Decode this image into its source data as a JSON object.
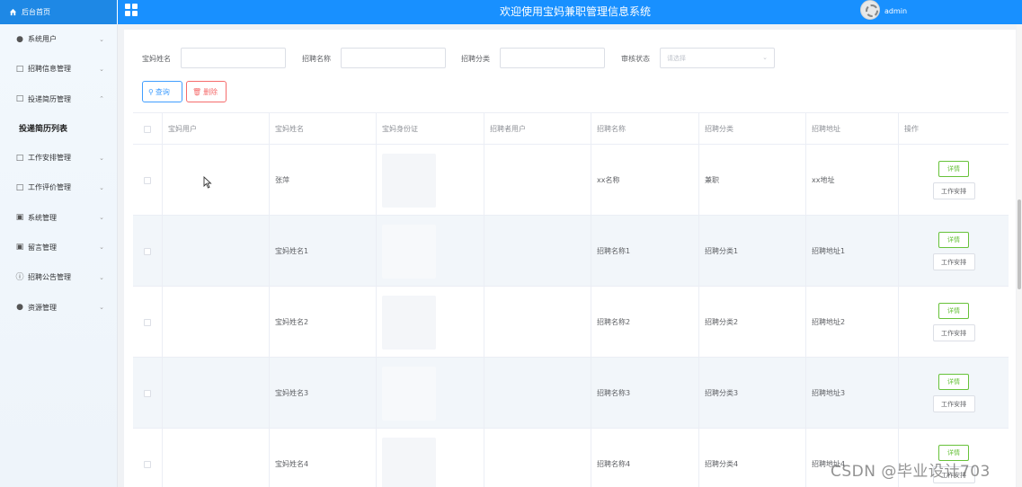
{
  "header": {
    "home_label": "后台首页",
    "title": "欢迎使用宝妈兼职管理信息系统",
    "username": "admin"
  },
  "sidebar": {
    "items": [
      {
        "label": "系统用户",
        "icon": "user-icon",
        "chevron": "down"
      },
      {
        "label": "招聘信息管理",
        "icon": "document-icon",
        "chevron": "down"
      },
      {
        "label": "投递简历管理",
        "icon": "document-icon",
        "chevron": "up"
      },
      {
        "label": "工作安排管理",
        "icon": "document-icon",
        "chevron": "down"
      },
      {
        "label": "工作评价管理",
        "icon": "document-icon",
        "chevron": "down"
      },
      {
        "label": "系统管理",
        "icon": "picture-icon",
        "chevron": "down"
      },
      {
        "label": "留言管理",
        "icon": "picture-icon",
        "chevron": "down"
      },
      {
        "label": "招聘公告管理",
        "icon": "info-icon",
        "chevron": "down"
      },
      {
        "label": "资源管理",
        "icon": "location-icon",
        "chevron": "down"
      }
    ],
    "active_submenu": "投递简历列表"
  },
  "filters": {
    "name_label": "宝妈姓名",
    "name_value": "",
    "job_label": "招聘名称",
    "job_value": "",
    "category_label": "招聘分类",
    "category_value": "",
    "status_label": "审核状态",
    "status_placeholder": "请选择"
  },
  "actions": {
    "query_label": "查询",
    "delete_label": "删除"
  },
  "table": {
    "columns": [
      "宝妈用户",
      "宝妈姓名",
      "宝妈身份证",
      "招聘者用户",
      "招聘名称",
      "招聘分类",
      "招聘地址",
      "操作"
    ],
    "rows": [
      {
        "user": "",
        "name": "张萍",
        "recruiter": "",
        "job": "xx名称",
        "category": "兼职",
        "address": "xx地址"
      },
      {
        "user": "",
        "name": "宝妈姓名1",
        "recruiter": "",
        "job": "招聘名称1",
        "category": "招聘分类1",
        "address": "招聘地址1"
      },
      {
        "user": "",
        "name": "宝妈姓名2",
        "recruiter": "",
        "job": "招聘名称2",
        "category": "招聘分类2",
        "address": "招聘地址2"
      },
      {
        "user": "",
        "name": "宝妈姓名3",
        "recruiter": "",
        "job": "招聘名称3",
        "category": "招聘分类3",
        "address": "招聘地址3"
      },
      {
        "user": "",
        "name": "宝妈姓名4",
        "recruiter": "",
        "job": "招聘名称4",
        "category": "招聘分类4",
        "address": "招聘地址4"
      }
    ],
    "row_actions": {
      "detail_label": "详情",
      "work_label": "工作安排"
    }
  },
  "watermark": "CSDN @毕业设计703",
  "colors": {
    "header_bg": "#1890ff",
    "primary": "#409eff",
    "danger": "#f56c6c",
    "success": "#67c23a"
  }
}
